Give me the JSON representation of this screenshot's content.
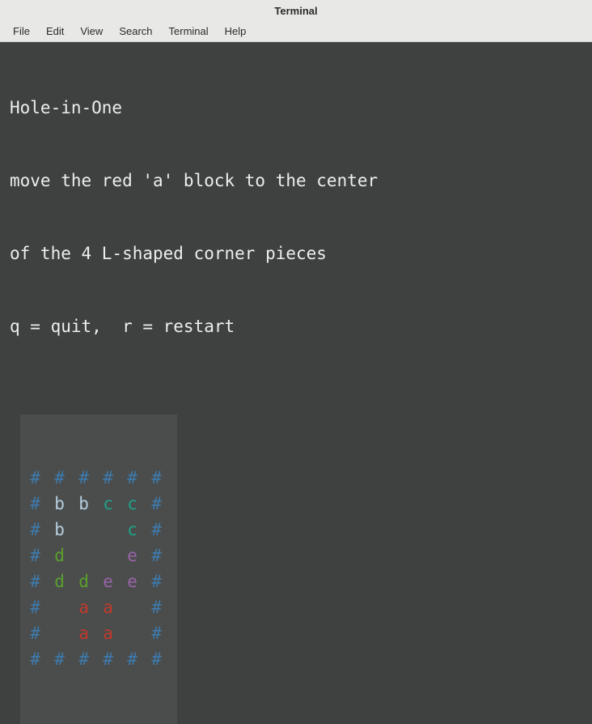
{
  "window": {
    "title": "Terminal"
  },
  "menubar": {
    "items": [
      "File",
      "Edit",
      "View",
      "Search",
      "Terminal",
      "Help"
    ]
  },
  "game": {
    "title": "Hole-in-One",
    "instruction_line1": "move the red 'a' block to the center",
    "instruction_line2": "of the 4 L-shaped corner pieces",
    "keys": "q = quit,  r = restart"
  },
  "colors": {
    "wall": "#3f7aac",
    "b": "#b7cfe0",
    "c": "#1ea189",
    "d": "#5aa02c",
    "e": "#9a63a8",
    "a": "#c03a2b",
    "text": "#eeeeee"
  },
  "board": {
    "rows": [
      [
        {
          "ch": "#",
          "c": "wall"
        },
        {
          "ch": "#",
          "c": "wall"
        },
        {
          "ch": "#",
          "c": "wall"
        },
        {
          "ch": "#",
          "c": "wall"
        },
        {
          "ch": "#",
          "c": "wall"
        },
        {
          "ch": "#",
          "c": "wall"
        }
      ],
      [
        {
          "ch": "#",
          "c": "wall"
        },
        {
          "ch": "b",
          "c": "b"
        },
        {
          "ch": "b",
          "c": "b"
        },
        {
          "ch": "c",
          "c": "c"
        },
        {
          "ch": "c",
          "c": "c"
        },
        {
          "ch": "#",
          "c": "wall"
        }
      ],
      [
        {
          "ch": "#",
          "c": "wall"
        },
        {
          "ch": "b",
          "c": "b"
        },
        {
          "ch": " ",
          "c": "text"
        },
        {
          "ch": " ",
          "c": "text"
        },
        {
          "ch": "c",
          "c": "c"
        },
        {
          "ch": "#",
          "c": "wall"
        }
      ],
      [
        {
          "ch": "#",
          "c": "wall"
        },
        {
          "ch": "d",
          "c": "d"
        },
        {
          "ch": " ",
          "c": "text"
        },
        {
          "ch": " ",
          "c": "text"
        },
        {
          "ch": "e",
          "c": "e"
        },
        {
          "ch": "#",
          "c": "wall"
        }
      ],
      [
        {
          "ch": "#",
          "c": "wall"
        },
        {
          "ch": "d",
          "c": "d"
        },
        {
          "ch": "d",
          "c": "d"
        },
        {
          "ch": "e",
          "c": "e"
        },
        {
          "ch": "e",
          "c": "e"
        },
        {
          "ch": "#",
          "c": "wall"
        }
      ],
      [
        {
          "ch": "#",
          "c": "wall"
        },
        {
          "ch": " ",
          "c": "text"
        },
        {
          "ch": "a",
          "c": "a"
        },
        {
          "ch": "a",
          "c": "a"
        },
        {
          "ch": " ",
          "c": "text"
        },
        {
          "ch": "#",
          "c": "wall"
        }
      ],
      [
        {
          "ch": "#",
          "c": "wall"
        },
        {
          "ch": " ",
          "c": "text"
        },
        {
          "ch": "a",
          "c": "a"
        },
        {
          "ch": "a",
          "c": "a"
        },
        {
          "ch": " ",
          "c": "text"
        },
        {
          "ch": "#",
          "c": "wall"
        }
      ],
      [
        {
          "ch": "#",
          "c": "wall"
        },
        {
          "ch": "#",
          "c": "wall"
        },
        {
          "ch": "#",
          "c": "wall"
        },
        {
          "ch": "#",
          "c": "wall"
        },
        {
          "ch": "#",
          "c": "wall"
        },
        {
          "ch": "#",
          "c": "wall"
        }
      ]
    ]
  }
}
